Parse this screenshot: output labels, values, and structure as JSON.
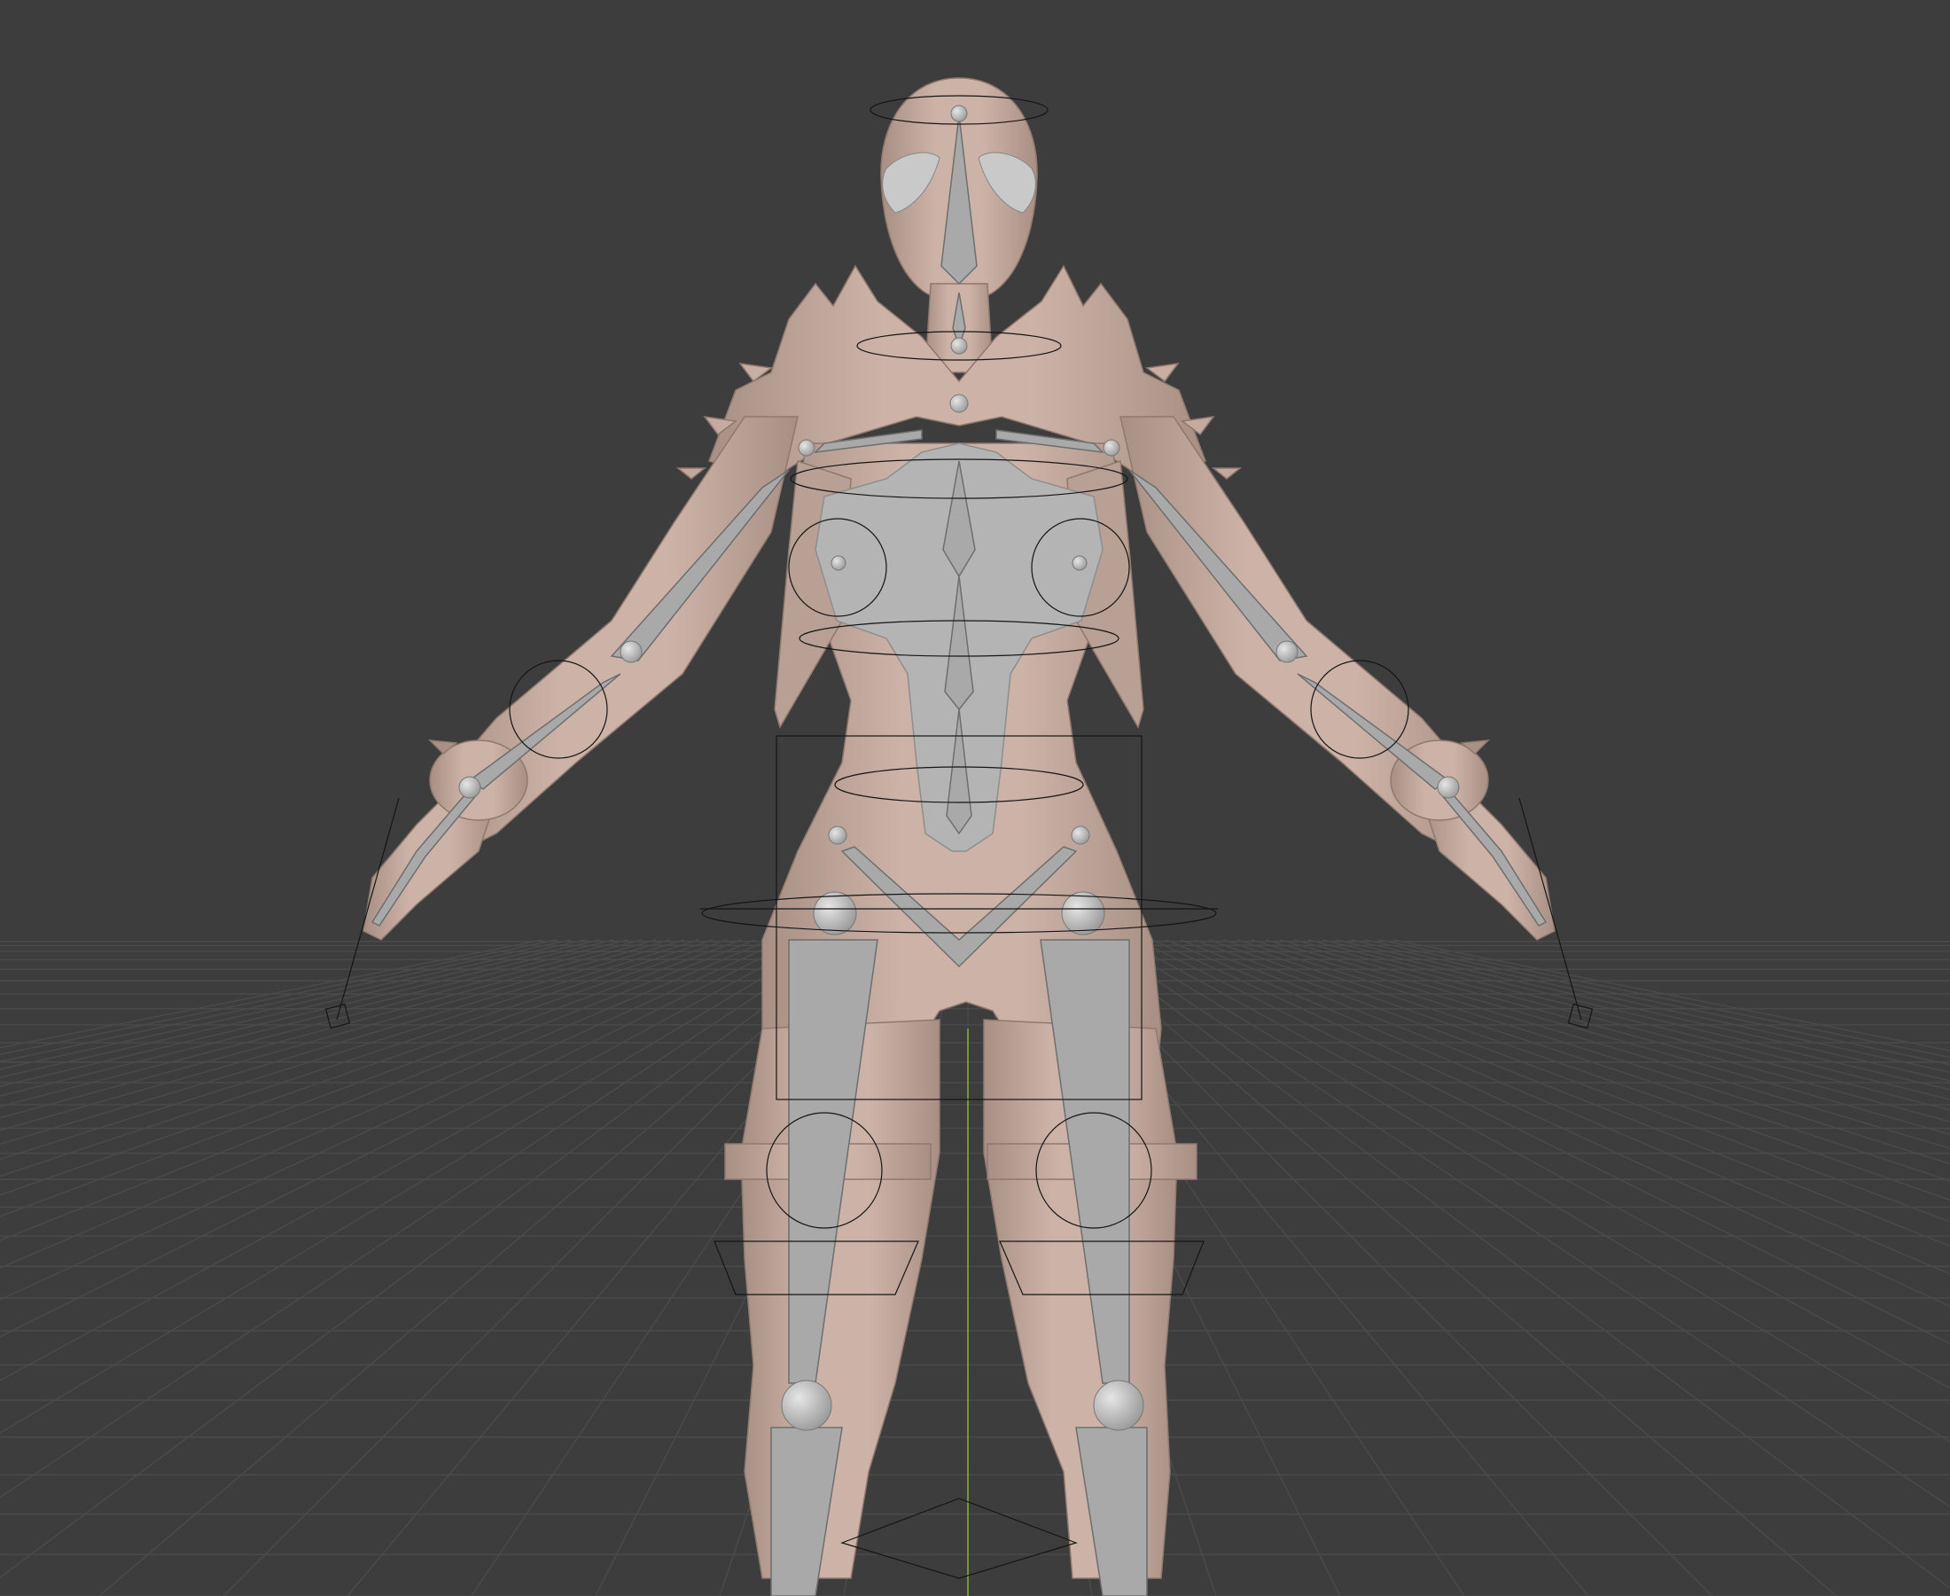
{
  "viewport": {
    "background_color": "#3d3d3d",
    "grid_line_color": "#4a4a4a",
    "y_axis_color": "#6f9a2d",
    "mesh_color": "#c8ada1",
    "mesh_shadow_color": "#a88f84",
    "bone_color": "#a9a9a9",
    "bone_highlight_color": "#c3c3c3",
    "wire_color": "#111111"
  },
  "scene": {
    "object": "character-mesh",
    "armature": "armature-rig",
    "view": "front",
    "shading": "solid"
  }
}
